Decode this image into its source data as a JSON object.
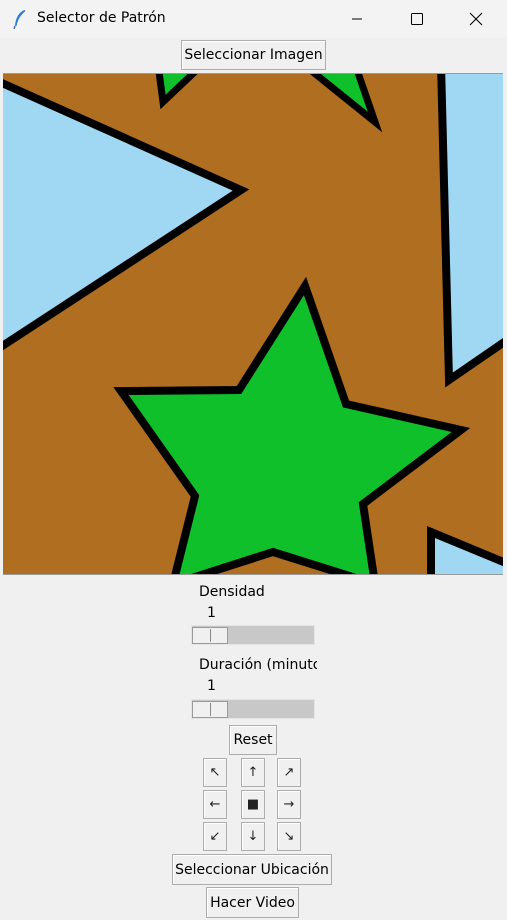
{
  "window": {
    "title": "Selector de Patrón",
    "app_icon": "feather-icon",
    "controls": {
      "minimize": "minimize-icon",
      "maximize": "maximize-icon",
      "close": "close-icon"
    }
  },
  "toolbar": {
    "select_image_label": "Seleccionar Imagen"
  },
  "canvas": {
    "colors": {
      "background": "#b06e20",
      "star": "#10c02a",
      "triangle": "#a0d8f4",
      "outline": "#000000"
    }
  },
  "controls": {
    "density": {
      "label": "Densidad",
      "value": "1"
    },
    "duration": {
      "label": "Duración (minutos",
      "value": "1"
    },
    "reset_label": "Reset",
    "direction_pad": {
      "up_left": "↖",
      "up": "↑",
      "up_right": "↗",
      "left": "←",
      "center": "■",
      "right": "→",
      "down_left": "↙",
      "down": "↓",
      "down_right": "↘"
    },
    "select_location_label": "Seleccionar Ubicación",
    "make_video_label": "Hacer Video"
  }
}
